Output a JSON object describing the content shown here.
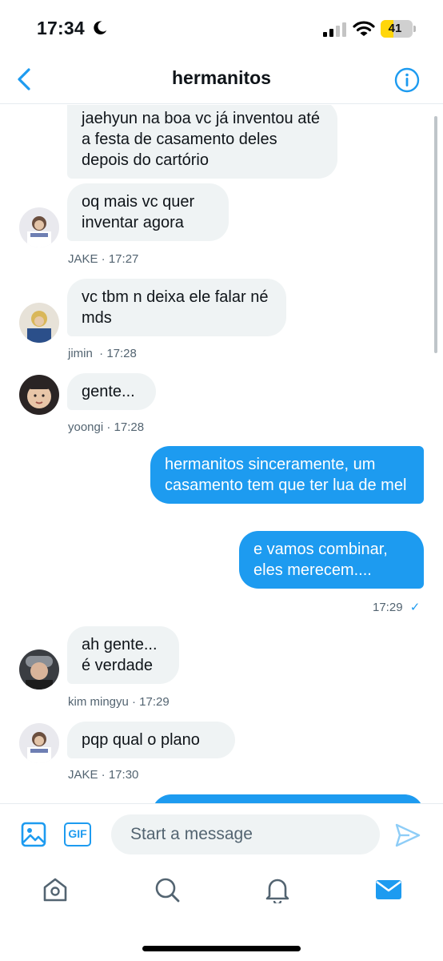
{
  "status": {
    "time": "17:34",
    "battery": "41",
    "battery_level": 0.41
  },
  "header": {
    "title": "hermanitos",
    "back_icon": "chevron-left-icon",
    "info_icon": "info-icon"
  },
  "messages": [
    {
      "text": "jaehyun na boa vc já inventou até a festa de casamento deles depois do cartório",
      "direction": "in"
    },
    {
      "text": "oq mais vc quer inventar agora",
      "direction": "in",
      "sender": "JAKE",
      "time": "17:27"
    },
    {
      "text": "vc tbm n deixa ele falar né mds",
      "direction": "in",
      "sender": "jimin",
      "time": "17:28"
    },
    {
      "text": "gente...",
      "direction": "in",
      "sender": "yoongi",
      "time": "17:28"
    },
    {
      "text": "hermanitos sinceramente, um casamento tem que ter lua de mel",
      "direction": "out"
    },
    {
      "text": "e vamos combinar, eles merecem....",
      "direction": "out",
      "time": "17:29",
      "status": "✓"
    },
    {
      "text": "ah gente... é verdade",
      "direction": "in",
      "sender": "kim mingyu",
      "time": "17:29"
    },
    {
      "text": "pqp qual o plano",
      "direction": "in",
      "sender": "JAKE",
      "time": "17:30"
    }
  ],
  "meta": {
    "jake1": "JAKE · 17:27",
    "jimin": "jimin  · 17:28",
    "yoongi": "yoongi · 17:28",
    "me": "17:29",
    "mingyu": "kim mingyu · 17:29",
    "jake2": "JAKE · 17:30"
  },
  "composer": {
    "placeholder": "Start a message",
    "gif_label": "GIF"
  },
  "tabs": [
    "home-icon",
    "search-icon",
    "notifications-icon",
    "messages-icon"
  ],
  "colors": {
    "accent": "#1d9bf0",
    "bubble_in": "#eff3f4",
    "meta_text": "#536471"
  }
}
